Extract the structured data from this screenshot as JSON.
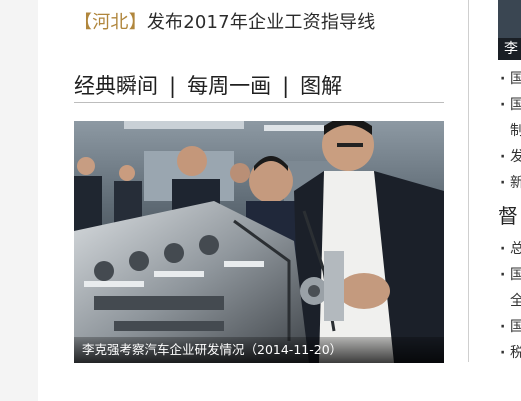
{
  "news": {
    "region": "【河北】",
    "title": "发布2017年企业工资指导线"
  },
  "tabs": [
    {
      "label": "经典瞬间"
    },
    {
      "label": "每周一画"
    },
    {
      "label": "图解"
    }
  ],
  "tab_separator": "|",
  "photo": {
    "caption": "李克强考察汽车企业研发情况（2014-11-20）"
  },
  "sidebar": {
    "thumb_caption": "李",
    "items_top": [
      {
        "text": "国"
      },
      {
        "text": "国",
        "cont": "制"
      },
      {
        "text": "发"
      },
      {
        "text": "新"
      }
    ],
    "heading": "督",
    "items_bottom": [
      {
        "text": "总"
      },
      {
        "text": "国",
        "cont": "全"
      },
      {
        "text": "国"
      },
      {
        "text": "税"
      }
    ]
  },
  "colors": {
    "region_tag": "#b0863c",
    "text": "#2b2b2b",
    "rule": "#bdbdbd"
  }
}
